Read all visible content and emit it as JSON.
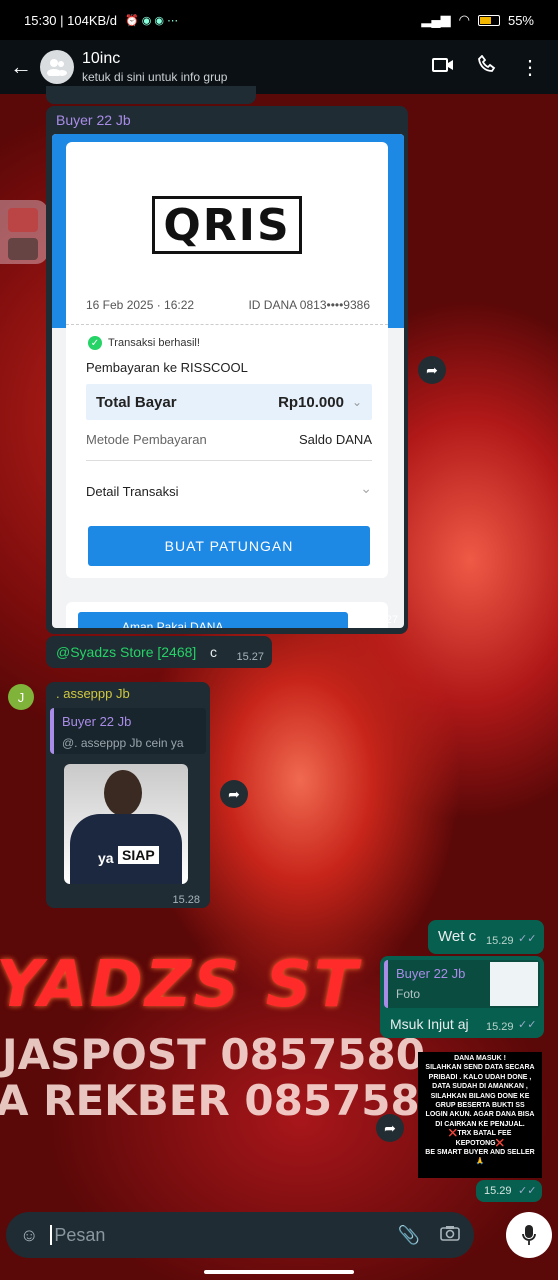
{
  "status": {
    "time_speed": "15:30 | 104KB/d",
    "icons": "⏰ ◉ ◉ ⋯",
    "battery": "55%"
  },
  "header": {
    "title": "10inc",
    "subtitle": "ketuk di sini untuk info grup"
  },
  "msg1": {
    "sender": "Buyer 22 Jb",
    "receipt": {
      "logo": "QRIS",
      "datetime": "16 Feb 2025 · 16:22",
      "account": "ID DANA 0813••••9386",
      "success": "Transaksi berhasil!",
      "payee": "Pembayaran ke RISSCOOL",
      "total_label": "Total Bayar",
      "total_value": "Rp10.000",
      "method_label": "Metode Pembayaran",
      "method_value": "Saldo DANA",
      "detail_label": "Detail Transaksi",
      "button": "BUAT PATUNGAN",
      "banner": "Aman Pakai DANA"
    },
    "time": "15.27"
  },
  "msg2": {
    "mention": "@Syadzs Store [2468]",
    "text": " c",
    "time": "15.27"
  },
  "msg3": {
    "avatar_letter": "J",
    "sender": ". asseppp Jb",
    "quote_sender": "Buyer 22 Jb",
    "quote_text": "@. asseppp Jb cein ya",
    "sticker_text1": "ya",
    "sticker_text2": "SIAP",
    "time": "15.28"
  },
  "bg_text": {
    "line1": "YADZS ST",
    "line2": "JASPOST 0857580",
    "line3": "A REKBER 0857580"
  },
  "msg4": {
    "text": "Wet c",
    "time": "15.29"
  },
  "msg5": {
    "quote_sender": "Buyer 22 Jb",
    "quote_text": "Foto",
    "text": "Msuk Injut aj",
    "time": "15.29"
  },
  "msg6": {
    "sticker_lines": [
      "DANA MASUK !",
      "SILAHKAN SEND DATA SECARA",
      "PRIBADI . KALO UDAH DONE ,",
      "DATA SUDAH DI AMANKAN ,",
      "SILAHKAN BILANG DONE KE",
      "GRUP BESERTA BUKTI SS",
      "LOGIN AKUN. AGAR DANA BISA",
      "DI CAIRKAN KE PENJUAL.",
      "❌TRX BATAL FEE",
      "KEPOTONG❌",
      "BE SMART BUYER AND SELLER",
      "🙏"
    ],
    "time": "15.29"
  },
  "input": {
    "placeholder": "Pesan"
  },
  "colors": {
    "accent_blue": "#1e88e5",
    "green_check": "#25d366",
    "header_bg": "#0b1014"
  }
}
